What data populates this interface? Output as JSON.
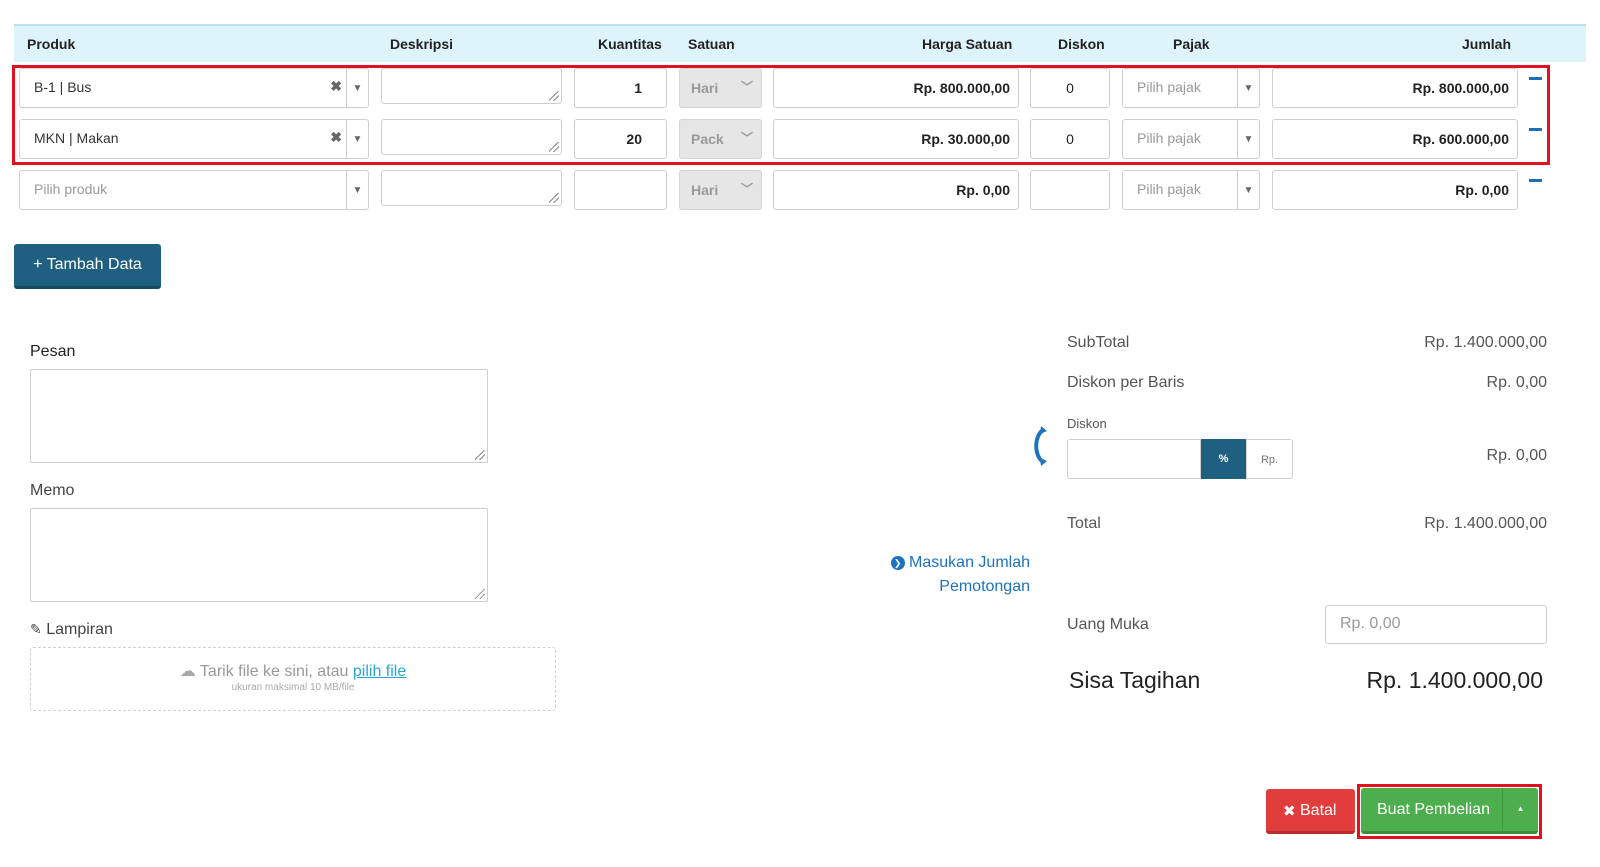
{
  "table": {
    "headers": {
      "produk": "Produk",
      "deskripsi": "Deskripsi",
      "kuantitas": "Kuantitas",
      "satuan": "Satuan",
      "harga": "Harga Satuan",
      "diskon": "Diskon",
      "pajak": "Pajak",
      "jumlah": "Jumlah"
    },
    "rows": [
      {
        "produk": "B-1 | Bus",
        "kuantitas": "1",
        "satuan": "Hari",
        "harga": "Rp. 800.000,00",
        "diskon": "0",
        "pajak": "Pilih pajak",
        "jumlah": "Rp. 800.000,00",
        "clear": "✖",
        "arrow": "▼"
      },
      {
        "produk": "MKN | Makan",
        "kuantitas": "20",
        "satuan": "Pack",
        "harga": "Rp. 30.000,00",
        "diskon": "0",
        "pajak": "Pilih pajak",
        "jumlah": "Rp. 600.000,00",
        "clear": "✖",
        "arrow": "▼"
      },
      {
        "produk": "Pilih produk",
        "kuantitas": "",
        "satuan": "Hari",
        "harga": "Rp. 0,00",
        "diskon": "",
        "pajak": "Pilih pajak",
        "jumlah": "Rp. 0,00",
        "clear": "",
        "arrow": "▼"
      }
    ],
    "chevron": "﹀"
  },
  "add_button": "+ Tambah Data",
  "form": {
    "pesan_label": "Pesan",
    "memo_label": "Memo",
    "lampiran_label": "Lampiran",
    "paperclip_icon": "✎",
    "dropzone_text": "Tarik file ke sini, atau ",
    "dropzone_link": "pilih file",
    "dropzone_hint": "ukuran maksimal 10 MB/file",
    "cloud_icon": "☁"
  },
  "deduction_link": {
    "icon": "❯",
    "line1": "Masukan Jumlah",
    "line2": "Pemotongan"
  },
  "summary": {
    "subtotal_label": "SubTotal",
    "subtotal_value": "Rp. 1.400.000,00",
    "diskon_baris_label": "Diskon per Baris",
    "diskon_baris_value": "Rp. 0,00",
    "diskon_label": "Diskon",
    "diskon_percent_btn": "%",
    "diskon_rp_btn": "Rp.",
    "diskon_value": "Rp. 0,00",
    "total_label": "Total",
    "total_value": "Rp. 1.400.000,00",
    "uang_muka_label": "Uang Muka",
    "uang_muka_placeholder": "Rp. 0,00",
    "sisa_label": "Sisa Tagihan",
    "sisa_value": "Rp. 1.400.000,00"
  },
  "actions": {
    "batal_icon": "✖",
    "batal_label": "Batal",
    "buat_label": "Buat Pembelian",
    "caret": "▲"
  },
  "colors": {
    "header_bg": "#def4fb",
    "primary": "#1f5f7f",
    "danger": "#e23d3d",
    "success": "#4cae4c",
    "highlight": "#e3101f"
  }
}
